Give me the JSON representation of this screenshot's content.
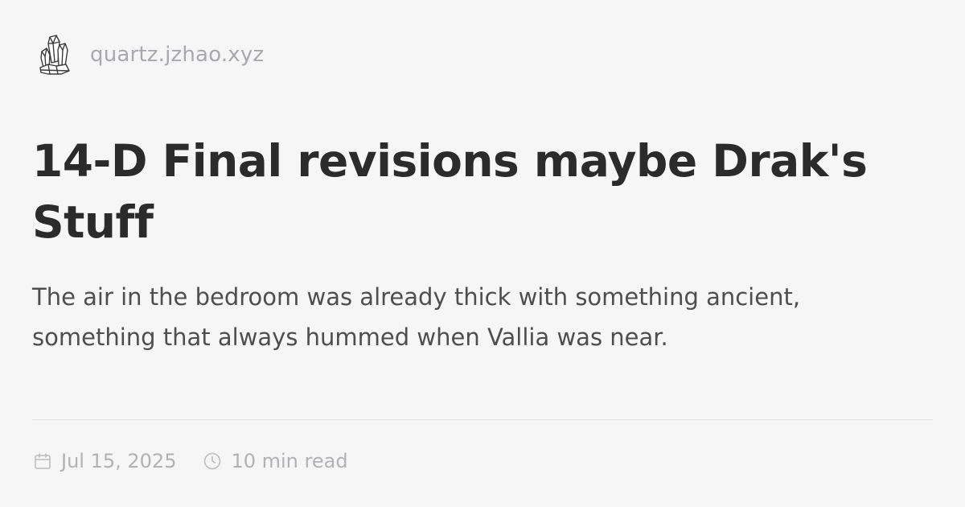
{
  "site": {
    "icon": "crystal-logo-icon",
    "name": "quartz.jzhao.xyz"
  },
  "article": {
    "title": "14-D Final revisions maybe Drak's Stuff",
    "description": "The air in the bedroom was already thick with something ancient, something that always hummed when Vallia was near."
  },
  "meta": {
    "date_icon": "calendar-icon",
    "date": "Jul 15, 2025",
    "reading_time_icon": "clock-icon",
    "reading_time": "10 min read"
  },
  "colors": {
    "background": "#f7f6f7",
    "title": "#2b2b2b",
    "description": "#4e4e4e",
    "muted": "#b2b1b4",
    "divider": "#e5e4e5"
  }
}
